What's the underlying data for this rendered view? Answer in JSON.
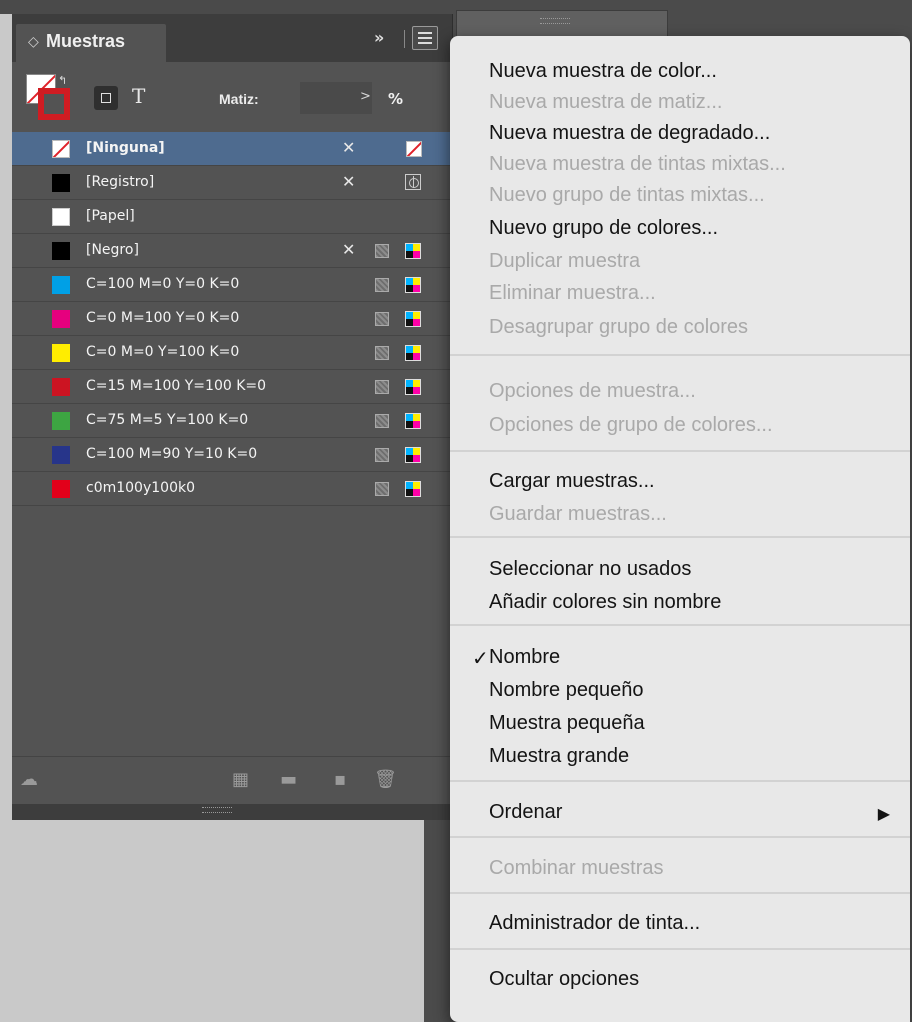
{
  "panel": {
    "title": "Muestras",
    "tab_arrows": "◇",
    "collapse": "»",
    "tint_label": "Matiz:",
    "tint_value": "",
    "tint_arrow": ">",
    "tint_unit": "%",
    "text_button": "T",
    "swatches": [
      {
        "name": "[Ninguna]",
        "color": "none",
        "selected": true,
        "locked": true,
        "right_icon": "none-icon"
      },
      {
        "name": "[Registro]",
        "color": "#000000",
        "locked": true,
        "right_icon": "registration-icon"
      },
      {
        "name": "[Papel]",
        "color": "#ffffff"
      },
      {
        "name": "[Negro]",
        "color": "#000000",
        "locked": true,
        "right_icon": "cmyk-icon",
        "process": true
      },
      {
        "name": "C=100 M=0 Y=0 K=0",
        "color": "#00a0e6",
        "right_icon": "cmyk-icon",
        "process": true
      },
      {
        "name": "C=0 M=100 Y=0 K=0",
        "color": "#e6007e",
        "right_icon": "cmyk-icon",
        "process": true
      },
      {
        "name": "C=0 M=0 Y=100 K=0",
        "color": "#ffed00",
        "right_icon": "cmyk-icon",
        "process": true
      },
      {
        "name": "C=15 M=100 Y=100 K=0",
        "color": "#cc1422",
        "right_icon": "cmyk-icon",
        "process": true
      },
      {
        "name": "C=75 M=5 Y=100 K=0",
        "color": "#3da542",
        "right_icon": "cmyk-icon",
        "process": true
      },
      {
        "name": "C=100 M=90 Y=10 K=0",
        "color": "#27358a",
        "right_icon": "cmyk-icon",
        "process": true
      },
      {
        "name": "c0m100y100k0",
        "color": "#e2001a",
        "right_icon": "cmyk-icon",
        "process": true
      }
    ]
  },
  "menu": {
    "items": [
      {
        "label": "Nueva muestra de color...",
        "enabled": true
      },
      {
        "label": "Nueva muestra de matiz...",
        "enabled": false
      },
      {
        "label": "Nueva muestra de degradado...",
        "enabled": true
      },
      {
        "label": "Nueva muestra de tintas mixtas...",
        "enabled": false
      },
      {
        "label": "Nuevo grupo de tintas mixtas...",
        "enabled": false
      },
      {
        "label": "Nuevo grupo de colores...",
        "enabled": true
      },
      {
        "label": "Duplicar muestra",
        "enabled": false
      },
      {
        "label": "Eliminar muestra...",
        "enabled": false
      },
      {
        "label": "Desagrupar grupo de colores",
        "enabled": false
      },
      {
        "label": "Opciones de muestra...",
        "enabled": false
      },
      {
        "label": "Opciones de grupo de colores...",
        "enabled": false
      },
      {
        "label": "Cargar muestras...",
        "enabled": true
      },
      {
        "label": "Guardar muestras...",
        "enabled": false
      },
      {
        "label": "Seleccionar no usados",
        "enabled": true
      },
      {
        "label": "Añadir colores sin nombre",
        "enabled": true
      },
      {
        "label": "Nombre",
        "enabled": true,
        "checked": true
      },
      {
        "label": "Nombre pequeño",
        "enabled": true
      },
      {
        "label": "Muestra pequeña",
        "enabled": true
      },
      {
        "label": "Muestra grande",
        "enabled": true
      },
      {
        "label": "Ordenar",
        "enabled": true,
        "submenu": true
      },
      {
        "label": "Combinar muestras",
        "enabled": false
      },
      {
        "label": "Administrador de tinta...",
        "enabled": true
      },
      {
        "label": "Ocultar opciones",
        "enabled": true
      }
    ],
    "check_glyph": "✓",
    "submenu_glyph": "▶"
  }
}
